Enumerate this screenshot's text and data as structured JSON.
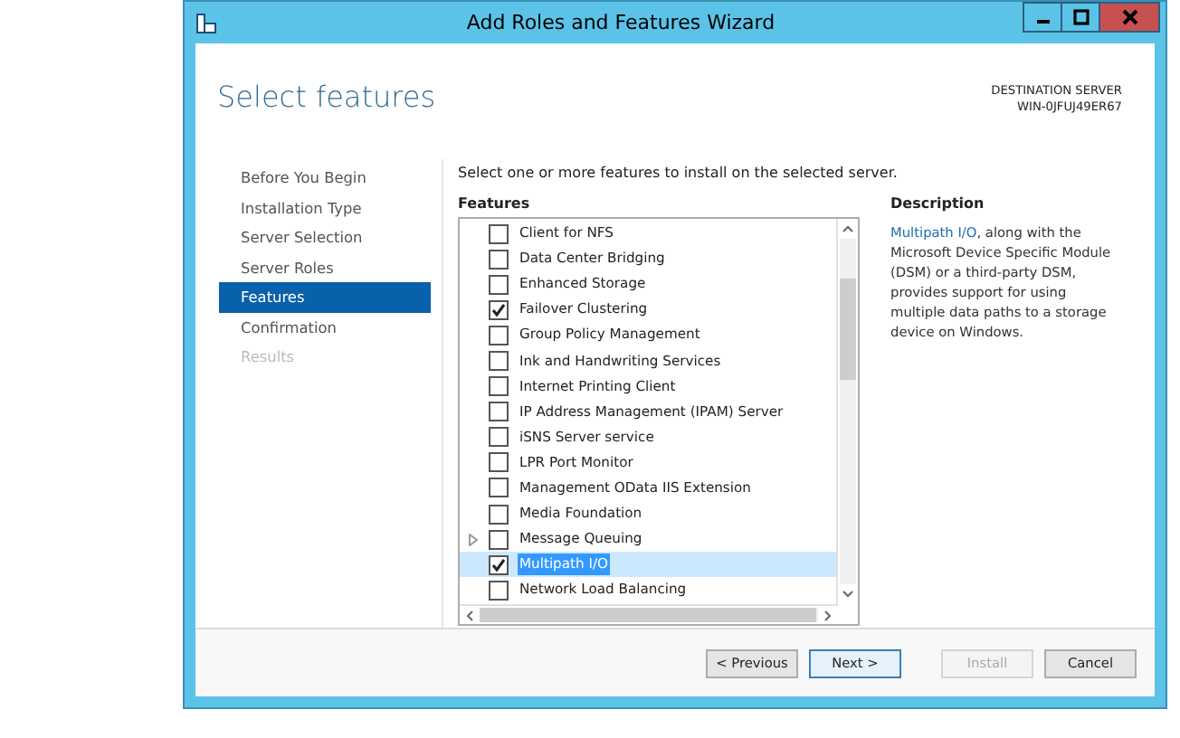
{
  "window": {
    "title": "Add Roles and Features Wizard"
  },
  "page_title": "Select features",
  "destination": {
    "label": "DESTINATION SERVER",
    "server": "WIN-0JFUJ49ER67"
  },
  "steps": [
    {
      "label": "Before You Begin",
      "selected": false,
      "disabled": false
    },
    {
      "label": "Installation Type",
      "selected": false,
      "disabled": false
    },
    {
      "label": "Server Selection",
      "selected": false,
      "disabled": false
    },
    {
      "label": "Server Roles",
      "selected": false,
      "disabled": false
    },
    {
      "label": "Features",
      "selected": true,
      "disabled": false
    },
    {
      "label": "Confirmation",
      "selected": false,
      "disabled": false
    },
    {
      "label": "Results",
      "selected": false,
      "disabled": true
    }
  ],
  "instruction": "Select one or more features to install on the selected server.",
  "features_heading": "Features",
  "features": [
    {
      "label": "Client for NFS",
      "checked": false,
      "selected": false,
      "expandable": false
    },
    {
      "label": "Data Center Bridging",
      "checked": false,
      "selected": false,
      "expandable": false
    },
    {
      "label": "Enhanced Storage",
      "checked": false,
      "selected": false,
      "expandable": false
    },
    {
      "label": "Failover Clustering",
      "checked": true,
      "selected": false,
      "expandable": false
    },
    {
      "label": "Group Policy Management",
      "checked": false,
      "selected": false,
      "expandable": false
    },
    {
      "label": "Ink and Handwriting Services",
      "checked": false,
      "selected": false,
      "expandable": false
    },
    {
      "label": "Internet Printing Client",
      "checked": false,
      "selected": false,
      "expandable": false
    },
    {
      "label": "IP Address Management (IPAM) Server",
      "checked": false,
      "selected": false,
      "expandable": false
    },
    {
      "label": "iSNS Server service",
      "checked": false,
      "selected": false,
      "expandable": false
    },
    {
      "label": "LPR Port Monitor",
      "checked": false,
      "selected": false,
      "expandable": false
    },
    {
      "label": "Management OData IIS Extension",
      "checked": false,
      "selected": false,
      "expandable": false
    },
    {
      "label": "Media Foundation",
      "checked": false,
      "selected": false,
      "expandable": false
    },
    {
      "label": "Message Queuing",
      "checked": false,
      "selected": false,
      "expandable": true
    },
    {
      "label": "Multipath I/O",
      "checked": true,
      "selected": true,
      "expandable": false
    },
    {
      "label": "Network Load Balancing",
      "checked": false,
      "selected": false,
      "expandable": false
    }
  ],
  "description": {
    "heading": "Description",
    "link": "Multipath I/O",
    "text": ", along with the Microsoft Device Specific Module (DSM) or a third-party DSM, provides support for using multiple data paths to a storage device on Windows."
  },
  "buttons": [
    {
      "label": "< Previous",
      "disabled": false,
      "default": false
    },
    {
      "label": "Next >",
      "disabled": false,
      "default": true
    },
    {
      "label": "Install",
      "disabled": true,
      "default": false
    },
    {
      "label": "Cancel",
      "disabled": false,
      "default": false
    }
  ]
}
